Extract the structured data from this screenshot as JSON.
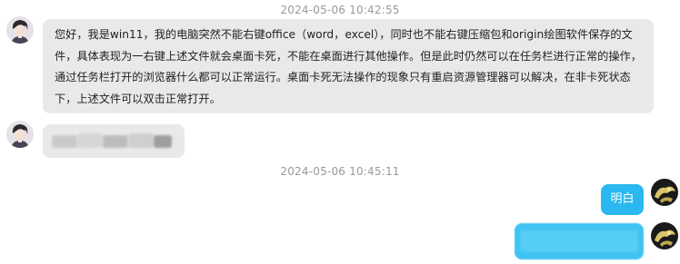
{
  "chat": {
    "timestamp_1": "2024-05-06 10:42:55",
    "timestamp_2": "2024-05-06 10:45:11",
    "message_1_lines": [
      "您好，我是win11，我的电脑突然不能右键office（word，excel），同时也不能右键压缩包和origin绘图软件保存的文",
      "件，具体表现为一右键上述文件就会桌面卡死，不能在桌面进行其他操作。但是此时仍然可以在任务栏进行正常的操作，",
      "通过任务栏打开的浏览器什么都可以正常运行。桌面卡死无法操作的现象只有重启资源管理器可以解决，在非卡死状态",
      "下，上述文件可以双击正常打开。"
    ],
    "message_reply": "明白"
  },
  "colors": {
    "left_bubble": "#e9e9e9",
    "right_bubble": "#29b8ef",
    "timestamp": "#999999"
  }
}
